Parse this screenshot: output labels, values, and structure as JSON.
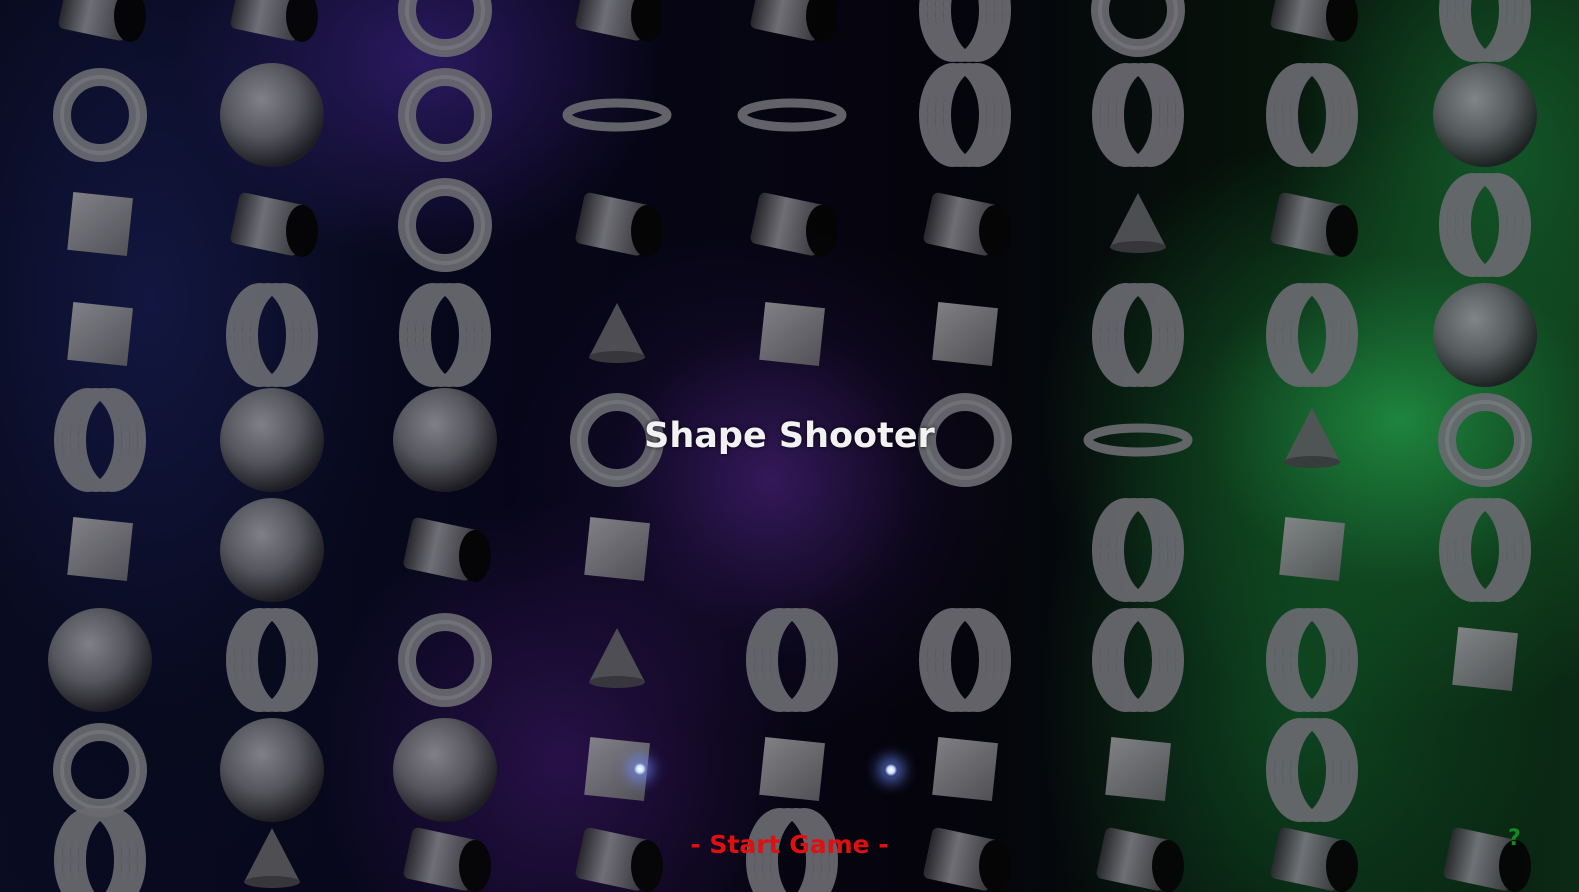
{
  "game": {
    "title": "Shape Shooter",
    "start_label": "- Start Game -",
    "help_label": "?"
  },
  "colors": {
    "title": "#f2f2f2",
    "start": "#e01010",
    "help": "#118a22",
    "shape": "#6e6e72",
    "shape_dark": "#2a2a2e",
    "nebula_purple": "#5a2896",
    "nebula_green": "#229646"
  },
  "background_shapes": {
    "types": [
      "sphere",
      "torus",
      "spring",
      "cube",
      "cylinder",
      "cone"
    ],
    "note_columns": 9
  }
}
